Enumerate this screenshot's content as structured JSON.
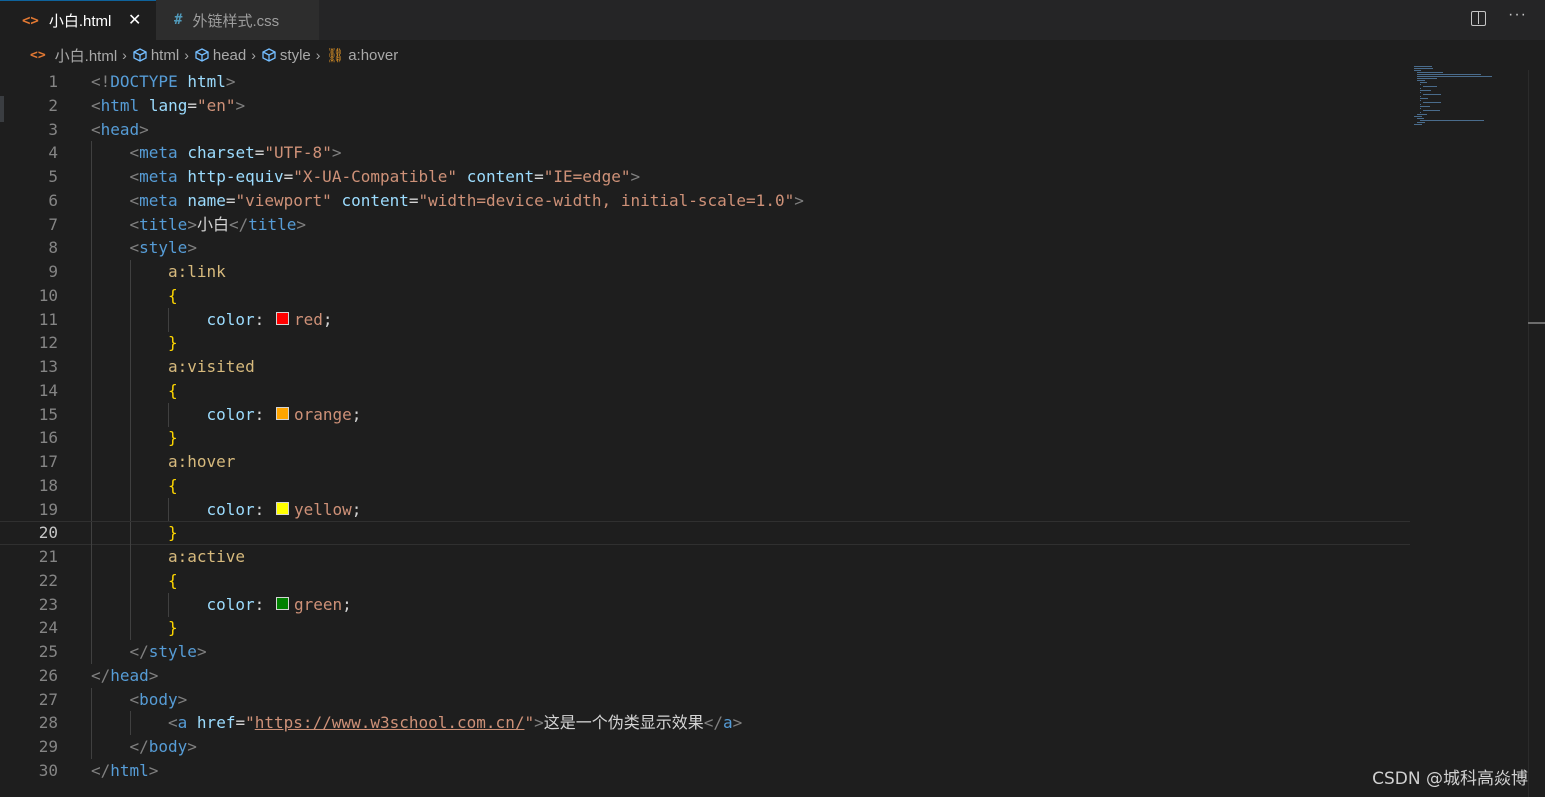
{
  "tabs": [
    {
      "icon": "<>",
      "label": "小白.html",
      "active": true,
      "close": "✕"
    },
    {
      "icon": "#",
      "label": "外链样式.css",
      "active": false
    }
  ],
  "toolbar": {
    "more": "···"
  },
  "breadcrumb": [
    "小白.html",
    "html",
    "head",
    "style",
    "a:hover"
  ],
  "editor": {
    "current_line": 20
  },
  "watermark": "CSDN @城科高焱博",
  "colors": {
    "red": "#ff0000",
    "orange": "#ffa500",
    "yellow": "#ffff00",
    "green": "#008000"
  },
  "lines": [
    {
      "n": "1",
      "indent": 0,
      "tokens": [
        [
          "t-punct",
          "<!"
        ],
        [
          "t-tag",
          "DOCTYPE"
        ],
        [
          "t-text",
          " "
        ],
        [
          "t-attr",
          "html"
        ],
        [
          "t-punct",
          ">"
        ]
      ]
    },
    {
      "n": "2",
      "indent": 0,
      "tokens": [
        [
          "t-punct",
          "<"
        ],
        [
          "t-tag",
          "html"
        ],
        [
          "t-text",
          " "
        ],
        [
          "t-attr",
          "lang"
        ],
        [
          "t-text",
          "="
        ],
        [
          "t-str",
          "\"en\""
        ],
        [
          "t-punct",
          ">"
        ]
      ]
    },
    {
      "n": "3",
      "indent": 0,
      "tokens": [
        [
          "t-punct",
          "<"
        ],
        [
          "t-tag",
          "head"
        ],
        [
          "t-punct",
          ">"
        ]
      ]
    },
    {
      "n": "4",
      "indent": 1,
      "tokens": [
        [
          "t-punct",
          "<"
        ],
        [
          "t-tag",
          "meta"
        ],
        [
          "t-text",
          " "
        ],
        [
          "t-attr",
          "charset"
        ],
        [
          "t-text",
          "="
        ],
        [
          "t-str",
          "\"UTF-8\""
        ],
        [
          "t-punct",
          ">"
        ]
      ]
    },
    {
      "n": "5",
      "indent": 1,
      "tokens": [
        [
          "t-punct",
          "<"
        ],
        [
          "t-tag",
          "meta"
        ],
        [
          "t-text",
          " "
        ],
        [
          "t-attr",
          "http-equiv"
        ],
        [
          "t-text",
          "="
        ],
        [
          "t-str",
          "\"X-UA-Compatible\""
        ],
        [
          "t-text",
          " "
        ],
        [
          "t-attr",
          "content"
        ],
        [
          "t-text",
          "="
        ],
        [
          "t-str",
          "\"IE=edge\""
        ],
        [
          "t-punct",
          ">"
        ]
      ]
    },
    {
      "n": "6",
      "indent": 1,
      "tokens": [
        [
          "t-punct",
          "<"
        ],
        [
          "t-tag",
          "meta"
        ],
        [
          "t-text",
          " "
        ],
        [
          "t-attr",
          "name"
        ],
        [
          "t-text",
          "="
        ],
        [
          "t-str",
          "\"viewport\""
        ],
        [
          "t-text",
          " "
        ],
        [
          "t-attr",
          "content"
        ],
        [
          "t-text",
          "="
        ],
        [
          "t-str",
          "\"width=device-width, initial-scale=1.0\""
        ],
        [
          "t-punct",
          ">"
        ]
      ]
    },
    {
      "n": "7",
      "indent": 1,
      "tokens": [
        [
          "t-punct",
          "<"
        ],
        [
          "t-tag",
          "title"
        ],
        [
          "t-punct",
          ">"
        ],
        [
          "t-text",
          "小白"
        ],
        [
          "t-punct",
          "</"
        ],
        [
          "t-tag",
          "title"
        ],
        [
          "t-punct",
          ">"
        ]
      ]
    },
    {
      "n": "8",
      "indent": 1,
      "tokens": [
        [
          "t-punct",
          "<"
        ],
        [
          "t-tag",
          "style"
        ],
        [
          "t-punct",
          ">"
        ]
      ]
    },
    {
      "n": "9",
      "indent": 2,
      "tokens": [
        [
          "t-sel",
          "a:link"
        ]
      ]
    },
    {
      "n": "10",
      "indent": 2,
      "tokens": [
        [
          "t-brace",
          "{"
        ]
      ]
    },
    {
      "n": "11",
      "indent": 3,
      "tokens": [
        [
          "t-prop",
          "color"
        ],
        [
          "t-text",
          ": "
        ],
        [
          "swatch",
          "red"
        ],
        [
          "t-val",
          "red"
        ],
        [
          "t-text",
          ";"
        ]
      ]
    },
    {
      "n": "12",
      "indent": 2,
      "tokens": [
        [
          "t-brace",
          "}"
        ]
      ]
    },
    {
      "n": "13",
      "indent": 2,
      "tokens": [
        [
          "t-sel",
          "a:visited"
        ]
      ]
    },
    {
      "n": "14",
      "indent": 2,
      "tokens": [
        [
          "t-brace",
          "{"
        ]
      ]
    },
    {
      "n": "15",
      "indent": 3,
      "tokens": [
        [
          "t-prop",
          "color"
        ],
        [
          "t-text",
          ": "
        ],
        [
          "swatch",
          "orange"
        ],
        [
          "t-val",
          "orange"
        ],
        [
          "t-text",
          ";"
        ]
      ]
    },
    {
      "n": "16",
      "indent": 2,
      "tokens": [
        [
          "t-brace",
          "}"
        ]
      ]
    },
    {
      "n": "17",
      "indent": 2,
      "tokens": [
        [
          "t-sel",
          "a:hover"
        ]
      ]
    },
    {
      "n": "18",
      "indent": 2,
      "tokens": [
        [
          "t-brace",
          "{"
        ]
      ]
    },
    {
      "n": "19",
      "indent": 3,
      "tokens": [
        [
          "t-prop",
          "color"
        ],
        [
          "t-text",
          ": "
        ],
        [
          "swatch",
          "yellow"
        ],
        [
          "t-val",
          "yellow"
        ],
        [
          "t-text",
          ";"
        ]
      ]
    },
    {
      "n": "20",
      "indent": 2,
      "tokens": [
        [
          "t-brace",
          "}"
        ]
      ]
    },
    {
      "n": "21",
      "indent": 2,
      "tokens": [
        [
          "t-sel",
          "a:active"
        ]
      ]
    },
    {
      "n": "22",
      "indent": 2,
      "tokens": [
        [
          "t-brace",
          "{"
        ]
      ]
    },
    {
      "n": "23",
      "indent": 3,
      "tokens": [
        [
          "t-prop",
          "color"
        ],
        [
          "t-text",
          ": "
        ],
        [
          "swatch",
          "green"
        ],
        [
          "t-val",
          "green"
        ],
        [
          "t-text",
          ";"
        ]
      ]
    },
    {
      "n": "24",
      "indent": 2,
      "tokens": [
        [
          "t-brace",
          "}"
        ]
      ]
    },
    {
      "n": "25",
      "indent": 1,
      "tokens": [
        [
          "t-punct",
          "</"
        ],
        [
          "t-tag",
          "style"
        ],
        [
          "t-punct",
          ">"
        ]
      ]
    },
    {
      "n": "26",
      "indent": 0,
      "tokens": [
        [
          "t-punct",
          "</"
        ],
        [
          "t-tag",
          "head"
        ],
        [
          "t-punct",
          ">"
        ]
      ]
    },
    {
      "n": "27",
      "indent": 1,
      "tokens": [
        [
          "t-punct",
          "<"
        ],
        [
          "t-tag",
          "body"
        ],
        [
          "t-punct",
          ">"
        ]
      ]
    },
    {
      "n": "28",
      "indent": 2,
      "tokens": [
        [
          "t-punct",
          "<"
        ],
        [
          "t-tag",
          "a"
        ],
        [
          "t-text",
          " "
        ],
        [
          "t-attr",
          "href"
        ],
        [
          "t-text",
          "="
        ],
        [
          "t-str",
          "\""
        ],
        [
          "t-link",
          "https://www.w3school.com.cn/"
        ],
        [
          "t-str",
          "\""
        ],
        [
          "t-punct",
          ">"
        ],
        [
          "t-text",
          "这是一个伪类显示效果"
        ],
        [
          "t-punct",
          "</"
        ],
        [
          "t-tag",
          "a"
        ],
        [
          "t-punct",
          ">"
        ]
      ]
    },
    {
      "n": "29",
      "indent": 1,
      "tokens": [
        [
          "t-punct",
          "</"
        ],
        [
          "t-tag",
          "body"
        ],
        [
          "t-punct",
          ">"
        ]
      ]
    },
    {
      "n": "30",
      "indent": 0,
      "tokens": [
        [
          "t-punct",
          "</"
        ],
        [
          "t-tag",
          "html"
        ],
        [
          "t-punct",
          ">"
        ]
      ]
    }
  ]
}
